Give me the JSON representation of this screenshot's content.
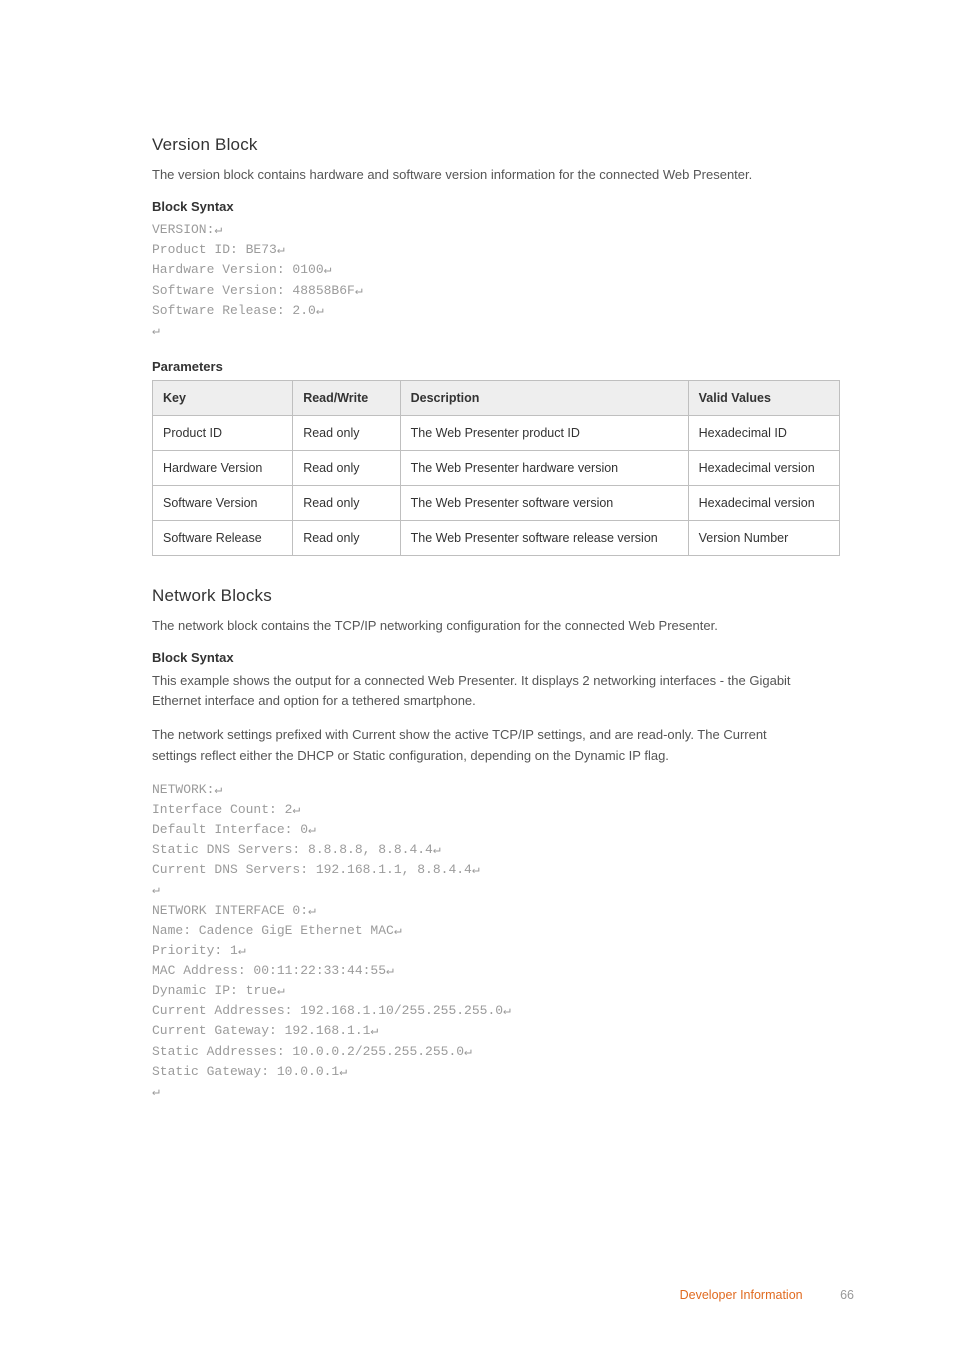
{
  "section1": {
    "title": "Version Block",
    "intro": "The version block contains hardware and software version information for the connected Web Presenter.",
    "block_syntax_label": "Block Syntax",
    "code": "VERSION:↵\nProduct ID: BE73↵\nHardware Version: 0100↵\nSoftware Version: 48858B6F↵\nSoftware Release: 2.0↵\n↵",
    "parameters_label": "Parameters",
    "table": {
      "headers": {
        "key": "Key",
        "rw": "Read/Write",
        "desc": "Description",
        "valid": "Valid Values"
      },
      "rows": [
        {
          "key": "Product ID",
          "rw": "Read only",
          "desc": "The Web Presenter product ID",
          "valid": "Hexadecimal ID"
        },
        {
          "key": "Hardware Version",
          "rw": "Read only",
          "desc": "The Web Presenter hardware version",
          "valid": "Hexadecimal version"
        },
        {
          "key": "Software Version",
          "rw": "Read only",
          "desc": "The Web Presenter software version",
          "valid": "Hexadecimal version"
        },
        {
          "key": "Software Release",
          "rw": "Read only",
          "desc": "The Web Presenter software release version",
          "valid": "Version Number"
        }
      ]
    }
  },
  "section2": {
    "title": "Network Blocks",
    "intro": "The network block contains the TCP/IP networking configuration for the connected Web Presenter.",
    "block_syntax_label": "Block Syntax",
    "para1": "This example shows the output for a connected Web Presenter. It displays 2 networking interfaces - the Gigabit Ethernet interface and option for a tethered smartphone.",
    "para2": "The network settings prefixed with Current show the active TCP/IP settings, and are read-only. The Current settings reflect either the DHCP or Static configuration, depending on the Dynamic IP flag.",
    "code": "NETWORK:↵\nInterface Count: 2↵\nDefault Interface: 0↵\nStatic DNS Servers: 8.8.8.8, 8.8.4.4↵\nCurrent DNS Servers: 192.168.1.1, 8.8.4.4↵\n↵\nNETWORK INTERFACE 0:↵\nName: Cadence GigE Ethernet MAC↵\nPriority: 1↵\nMAC Address: 00:11:22:33:44:55↵\nDynamic IP: true↵\nCurrent Addresses: 192.168.1.10/255.255.255.0↵\nCurrent Gateway: 192.168.1.1↵\nStatic Addresses: 10.0.0.2/255.255.255.0↵\nStatic Gateway: 10.0.0.1↵\n↵"
  },
  "footer": {
    "section_label": "Developer Information",
    "page_number": "66"
  }
}
